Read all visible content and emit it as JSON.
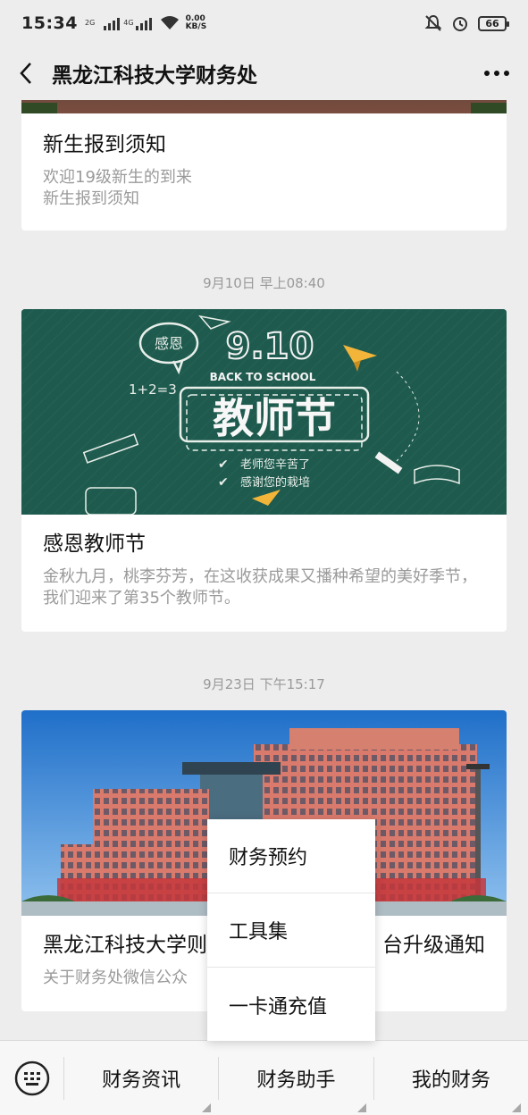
{
  "status_bar": {
    "time": "15:34",
    "signal1_label": "2G",
    "signal2_label": "4G",
    "net_speed_value": "0.00",
    "net_speed_unit": "KB/S",
    "battery": "66",
    "icons": [
      "signal-icon",
      "signal-icon",
      "wifi-icon",
      "mute-bell-icon",
      "alarm-icon",
      "battery-icon"
    ]
  },
  "navbar": {
    "title": "黑龙江科技大学财务处",
    "back_icon": "back-chevron-icon",
    "more_icon": "more-dots-icon"
  },
  "messages": [
    {
      "title": "新生报到须知",
      "digest_line1": "欢迎19级新生的到来",
      "digest_line2": "新生报到须知"
    },
    {
      "timestamp": "9月10日 早上08:40",
      "title": "感恩教师节",
      "digest": "金秋九月，桃李芬芳，在这收获成果又播种希望的美好季节，我们迎来了第35个教师节。",
      "cover": {
        "date_text": "9.10",
        "sub_text": "BACK TO SCHOOL",
        "main_text": "教师节",
        "badge_text": "感恩",
        "formula": "1+2=3",
        "line1": "老师您辛苦了",
        "line2": "感谢您的栽培"
      }
    },
    {
      "timestamp": "9月23日 下午15:17",
      "title_left": "黑龙江科技大学则",
      "title_right": "台升级通知",
      "digest_left": "关于财务处微信公众",
      "digest_right": "",
      "cover_desc": "campus-building-photo"
    }
  ],
  "bottom_menu": {
    "keyboard_icon": "keyboard-icon",
    "items": [
      {
        "label": "财务资讯"
      },
      {
        "label": "财务助手"
      },
      {
        "label": "我的财务"
      }
    ]
  },
  "popup_menu": {
    "items": [
      {
        "label": "财务预约"
      },
      {
        "label": "工具集"
      },
      {
        "label": "一卡通充值"
      }
    ]
  },
  "colors": {
    "background": "#ededed",
    "chalkboard": "#1f5a4e",
    "sky": "#2f7fd0",
    "building": "#d9786b"
  }
}
